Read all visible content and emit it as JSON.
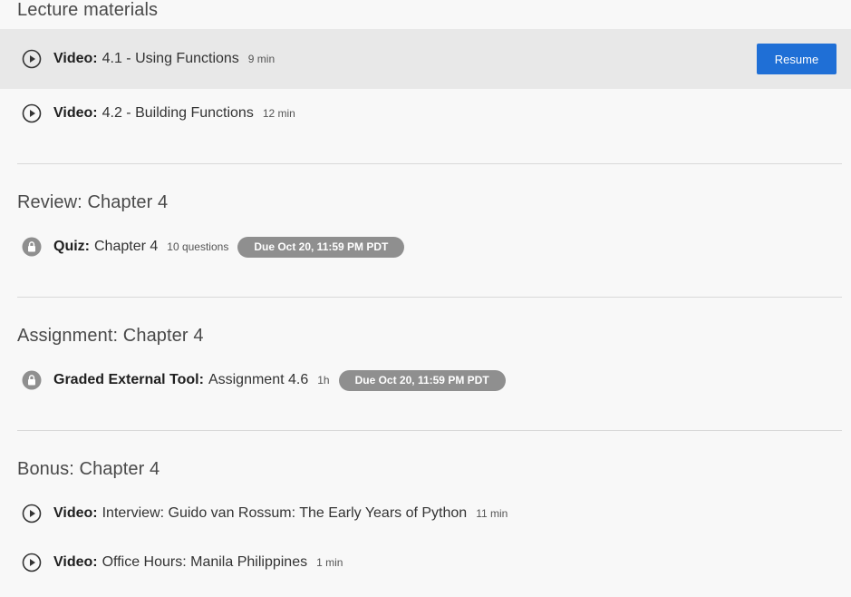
{
  "sections": [
    {
      "title": "Lecture materials",
      "items": [
        {
          "type": "Video:",
          "name": "4.1 - Using Functions",
          "meta": "9 min",
          "icon": "play-circle-icon",
          "action": "Resume"
        },
        {
          "type": "Video:",
          "name": "4.2 - Building Functions",
          "meta": "12 min",
          "icon": "play-circle-icon"
        }
      ]
    },
    {
      "title": "Review: Chapter 4",
      "items": [
        {
          "type": "Quiz:",
          "name": "Chapter 4",
          "meta": "10 questions",
          "icon": "lock-icon",
          "due": "Due Oct 20, 11:59 PM PDT"
        }
      ]
    },
    {
      "title": "Assignment: Chapter 4",
      "items": [
        {
          "type": "Graded External Tool:",
          "name": "Assignment 4.6",
          "meta": "1h",
          "icon": "lock-icon",
          "due": "Due Oct 20, 11:59 PM PDT"
        }
      ]
    },
    {
      "title": "Bonus: Chapter 4",
      "items": [
        {
          "type": "Video:",
          "name": "Interview: Guido van Rossum: The Early Years of Python",
          "meta": "11 min",
          "icon": "play-circle-icon"
        },
        {
          "type": "Video:",
          "name": "Office Hours: Manila Philippines",
          "meta": "1 min",
          "icon": "play-circle-icon"
        }
      ]
    }
  ],
  "colors": {
    "accent": "#1f6fd6",
    "badge": "#8f8f8f",
    "active_row": "#e8e8e8",
    "background": "#f8f8f8"
  }
}
